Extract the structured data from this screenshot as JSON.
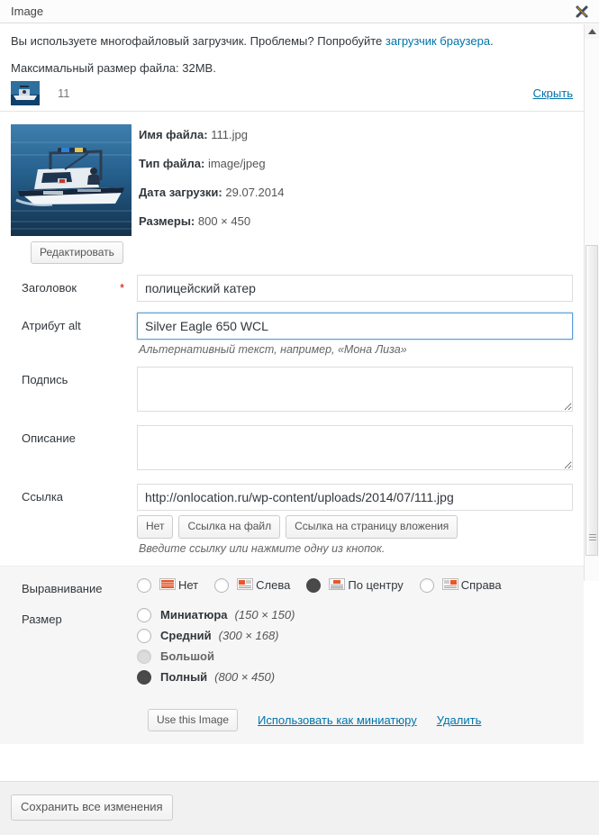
{
  "window": {
    "title": "Image",
    "close_label": "×"
  },
  "notice": {
    "text_before": "Вы используете многофайловый загрузчик. Проблемы? Попробуйте ",
    "link": "загрузчик браузера",
    "text_after": ".",
    "max_size": "Максимальный размер файла: 32MB."
  },
  "file_row": {
    "name": "11",
    "toggle": "Скрыть"
  },
  "meta": [
    {
      "label": "Имя файла:",
      "value": "111.jpg"
    },
    {
      "label": "Тип файла:",
      "value": "image/jpeg"
    },
    {
      "label": "Дата загрузки:",
      "value": "29.07.2014"
    },
    {
      "label": "Размеры:",
      "value": "800 × 450"
    }
  ],
  "edit_button": "Редактировать",
  "fields": {
    "title": {
      "label": "Заголовок",
      "required_mark": "*",
      "value": "полицейский катер"
    },
    "alt": {
      "label": "Атрибут alt",
      "value": "Silver Eagle 650 WCL",
      "hint": "Альтернативный текст, например, «Мона Лиза»"
    },
    "caption": {
      "label": "Подпись",
      "value": ""
    },
    "description": {
      "label": "Описание",
      "value": ""
    },
    "link": {
      "label": "Ссылка",
      "value": "http://onlocation.ru/wp-content/uploads/2014/07/111.jpg",
      "buttons": [
        "Нет",
        "Ссылка на файл",
        "Ссылка на страницу вложения"
      ],
      "hint": "Введите ссылку или нажмите одну из кнопок."
    }
  },
  "alignment": {
    "label": "Выравнивание",
    "selected": "center",
    "options": [
      {
        "id": "none",
        "label": "Нет",
        "icon": "align-none-icon",
        "checked": false
      },
      {
        "id": "left",
        "label": "Слева",
        "icon": "align-left-icon",
        "checked": false
      },
      {
        "id": "center",
        "label": "По центру",
        "icon": "align-center-icon",
        "checked": true
      },
      {
        "id": "right",
        "label": "Справа",
        "icon": "align-right-icon",
        "checked": false
      }
    ]
  },
  "size": {
    "label": "Размер",
    "selected": "full",
    "options": [
      {
        "id": "thumbnail",
        "name": "Миниатюра",
        "dims": "(150 × 150)",
        "checked": false,
        "disabled": false
      },
      {
        "id": "medium",
        "name": "Средний",
        "dims": "(300 × 168)",
        "checked": false,
        "disabled": false
      },
      {
        "id": "large",
        "name": "Большой",
        "dims": "",
        "checked": false,
        "disabled": true
      },
      {
        "id": "full",
        "name": "Полный",
        "dims": "(800 × 450)",
        "checked": true,
        "disabled": false
      }
    ]
  },
  "actions": {
    "use_image": "Use this Image",
    "use_as_thumbnail": "Использовать как миниатюру",
    "delete": "Удалить"
  },
  "footer": {
    "save_all": "Сохранить все изменения"
  },
  "colors": {
    "link": "#0073aa",
    "required": "#cc0000",
    "icon_orange": "#e8562b",
    "band_bg": "#f6f6f6",
    "footer_bg": "#f1f1f1"
  }
}
